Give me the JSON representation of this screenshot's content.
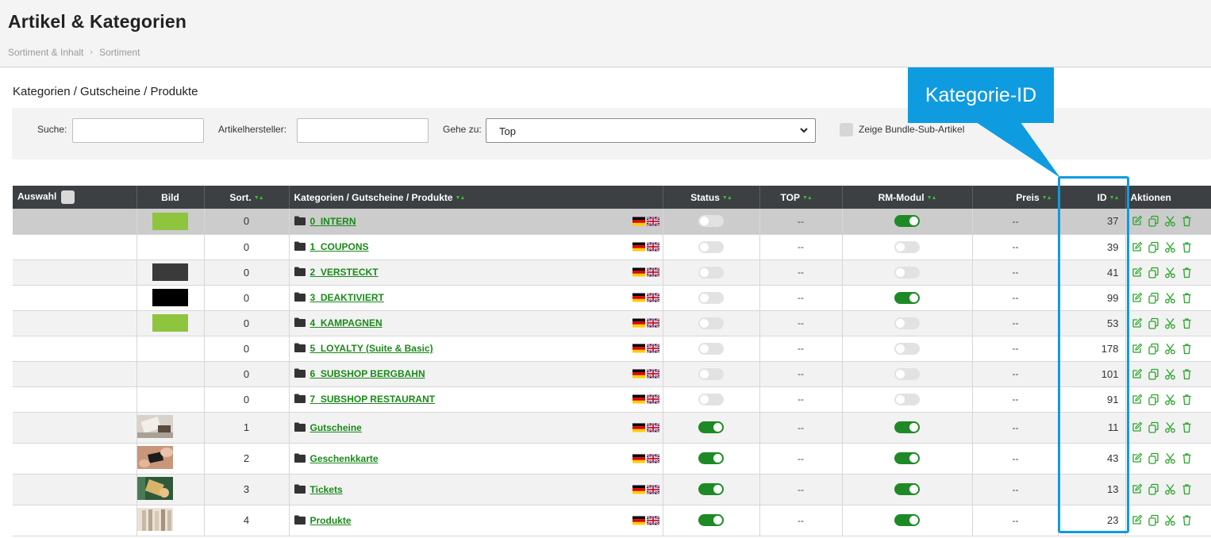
{
  "page": {
    "title": "Artikel & Kategorien",
    "breadcrumb": [
      "Sortiment & Inhalt",
      "Sortiment"
    ],
    "section_title": "Kategorien / Gutscheine / Produkte"
  },
  "filters": {
    "search_label": "Suche:",
    "search_value": "",
    "manufacturer_label": "Artikelhersteller:",
    "manufacturer_value": "",
    "goto_label": "Gehe zu:",
    "goto_selected": "Top",
    "bundle_label": "Zeige Bundle-Sub-Artikel"
  },
  "callout": {
    "label": "Kategorie-ID",
    "color": "#0f9be0"
  },
  "table": {
    "columns": {
      "selection": "Auswahl",
      "image": "Bild",
      "sort": "Sort.",
      "name": "Kategorien / Gutscheine / Produkte",
      "status": "Status",
      "top": "TOP",
      "rm": "RM-Modul",
      "price": "Preis",
      "id": "ID",
      "actions": "Aktionen"
    },
    "icons": {
      "folder": "folder-icon",
      "edit": "edit-icon",
      "copy": "copy-icon",
      "cut": "scissors-icon",
      "delete": "trash-icon",
      "flag_de": "flag-de-icon",
      "flag_uk": "flag-uk-icon"
    },
    "rows": [
      {
        "sort": "0",
        "name": "0_INTERN",
        "thumb": "#8fc43f",
        "status": false,
        "top": "--",
        "rm": true,
        "price": "--",
        "id": "37",
        "highlight": true
      },
      {
        "sort": "0",
        "name": "1_COUPONS",
        "thumb": "#ffffff",
        "status": false,
        "top": "--",
        "rm": false,
        "price": "--",
        "id": "39"
      },
      {
        "sort": "0",
        "name": "2_VERSTECKT",
        "thumb": "#3a3a3a",
        "status": false,
        "top": "--",
        "rm": false,
        "price": "--",
        "id": "41"
      },
      {
        "sort": "0",
        "name": "3_DEAKTIVIERT",
        "thumb": "#000000",
        "status": false,
        "top": "--",
        "rm": true,
        "price": "--",
        "id": "99"
      },
      {
        "sort": "0",
        "name": "4_KAMPAGNEN",
        "thumb": "#8fc43f",
        "status": false,
        "top": "--",
        "rm": false,
        "price": "--",
        "id": "53"
      },
      {
        "sort": "0",
        "name": "5_LOYALTY (Suite & Basic)",
        "thumb": "#ffffff",
        "status": false,
        "top": "--",
        "rm": false,
        "price": "--",
        "id": "178"
      },
      {
        "sort": "0",
        "name": "6_SUBSHOP BERGBAHN",
        "thumb": "",
        "status": false,
        "top": "--",
        "rm": false,
        "price": "--",
        "id": "101"
      },
      {
        "sort": "0",
        "name": "7_SUBSHOP RESTAURANT",
        "thumb": "#ffffff",
        "status": false,
        "top": "--",
        "rm": false,
        "price": "--",
        "id": "91"
      },
      {
        "sort": "1",
        "name": "Gutscheine",
        "thumb": "photo-gift",
        "status": true,
        "top": "--",
        "rm": true,
        "price": "--",
        "id": "11"
      },
      {
        "sort": "2",
        "name": "Geschenkkarte",
        "thumb": "photo-card",
        "status": true,
        "top": "--",
        "rm": true,
        "price": "--",
        "id": "43"
      },
      {
        "sort": "3",
        "name": "Tickets",
        "thumb": "photo-tickets",
        "status": true,
        "top": "--",
        "rm": true,
        "price": "--",
        "id": "13"
      },
      {
        "sort": "4",
        "name": "Produkte",
        "thumb": "photo-products",
        "status": true,
        "top": "--",
        "rm": true,
        "price": "--",
        "id": "23"
      }
    ]
  }
}
